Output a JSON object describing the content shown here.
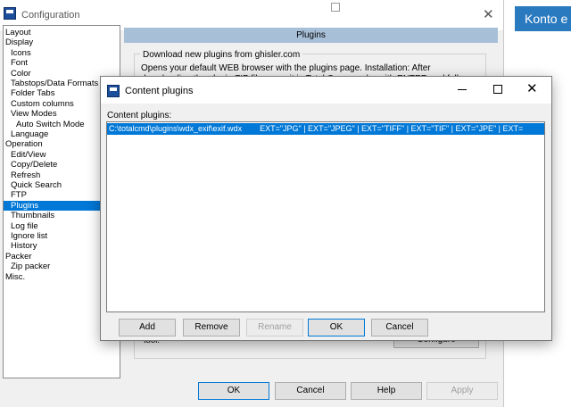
{
  "background": {
    "account_button": "Konto e"
  },
  "config_window": {
    "title": "Configuration",
    "tree": [
      {
        "label": "Layout",
        "indent": 0
      },
      {
        "label": "Display",
        "indent": 0
      },
      {
        "label": "Icons",
        "indent": 1
      },
      {
        "label": "Font",
        "indent": 1
      },
      {
        "label": "Color",
        "indent": 1
      },
      {
        "label": "Tabstops/Data Formats",
        "indent": 1
      },
      {
        "label": "Folder Tabs",
        "indent": 1
      },
      {
        "label": "Custom columns",
        "indent": 1
      },
      {
        "label": "View Modes",
        "indent": 1
      },
      {
        "label": "Auto Switch Mode",
        "indent": 2
      },
      {
        "label": "Language",
        "indent": 1
      },
      {
        "label": "Operation",
        "indent": 0
      },
      {
        "label": "Edit/View",
        "indent": 1
      },
      {
        "label": "Copy/Delete",
        "indent": 1
      },
      {
        "label": "Refresh",
        "indent": 1
      },
      {
        "label": "Quick Search",
        "indent": 1
      },
      {
        "label": "FTP",
        "indent": 1
      },
      {
        "label": "Plugins",
        "indent": 1,
        "selected": true
      },
      {
        "label": "Thumbnails",
        "indent": 1
      },
      {
        "label": "Log file",
        "indent": 1
      },
      {
        "label": "Ignore list",
        "indent": 1
      },
      {
        "label": "History",
        "indent": 1
      },
      {
        "label": "Packer",
        "indent": 0
      },
      {
        "label": "Zip packer",
        "indent": 1
      },
      {
        "label": "Misc.",
        "indent": 0
      }
    ],
    "section_header": "Plugins",
    "download_group_title": "Download new plugins from ghisler.com",
    "download_group_text": "Opens your default WEB browser with the plugins page. Installation: After downloading the plugin ZIP file, open it in Total Commander with ENTER and follow the instructions.",
    "tool_text": "tool.",
    "configure_label": "Configure",
    "buttons": {
      "ok": "OK",
      "cancel": "Cancel",
      "help": "Help",
      "apply": "Apply"
    }
  },
  "dialog": {
    "title": "Content plugins",
    "list_label": "Content plugins:",
    "plugins": [
      "C:\\totalcmd\\plugins\\wdx_exif\\exif.wdx        EXT=\"JPG\" | EXT=\"JPEG\" | EXT=\"TIFF\" | EXT=\"TIF\" | EXT=\"JPE\" | EXT="
    ],
    "buttons": {
      "add": "Add",
      "remove": "Remove",
      "rename": "Rename",
      "ok": "OK",
      "cancel": "Cancel"
    }
  }
}
